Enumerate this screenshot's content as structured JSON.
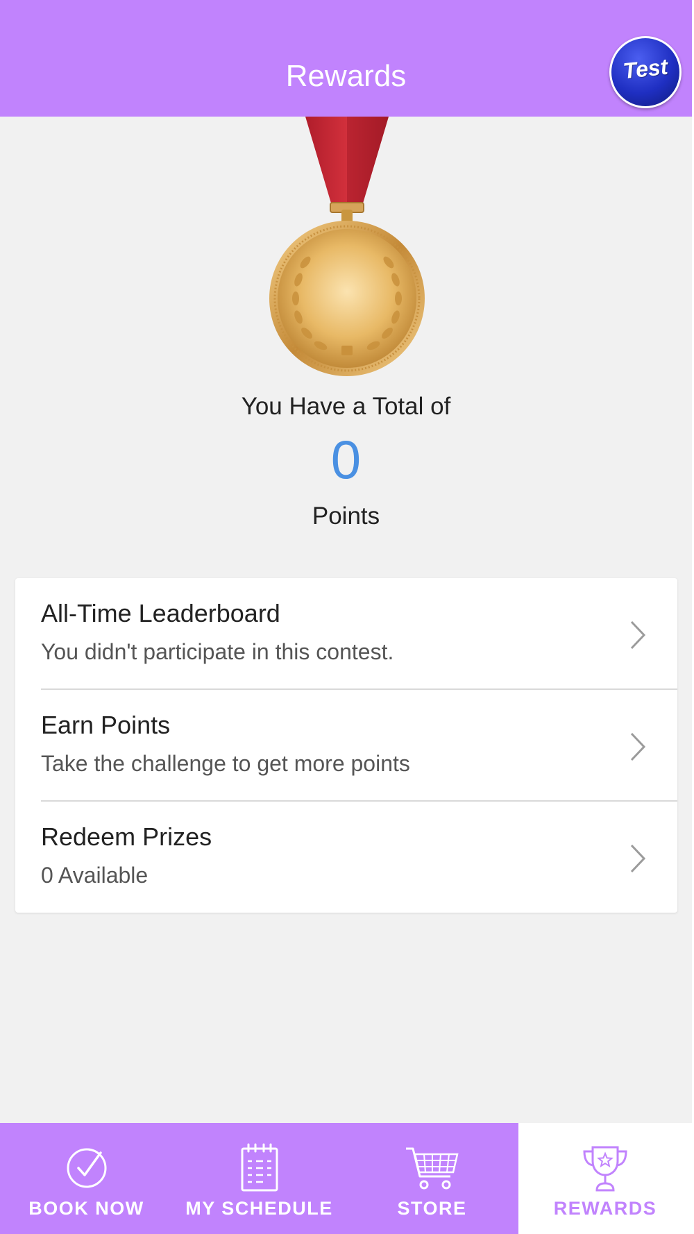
{
  "header": {
    "title": "Rewards",
    "avatar_text": "Test"
  },
  "summary": {
    "total_label": "You Have a Total of",
    "points_value": "0",
    "points_label": "Points"
  },
  "menu": {
    "items": [
      {
        "title": "All-Time Leaderboard",
        "subtitle": "You didn't participate in this contest."
      },
      {
        "title": "Earn Points",
        "subtitle": "Take the challenge to get more points"
      },
      {
        "title": "Redeem Prizes",
        "subtitle": "0 Available"
      }
    ]
  },
  "tabbar": {
    "tabs": [
      {
        "label": "BOOK NOW",
        "icon": "check-circle-icon",
        "active": false
      },
      {
        "label": "MY SCHEDULE",
        "icon": "calendar-icon",
        "active": false
      },
      {
        "label": "STORE",
        "icon": "cart-icon",
        "active": false
      },
      {
        "label": "REWARDS",
        "icon": "trophy-icon",
        "active": true
      }
    ]
  },
  "colors": {
    "brand_purple": "#c183fd",
    "points_blue": "#4a90e2",
    "ribbon_red": "#c0222f",
    "medal_gold": "#e2b35a"
  }
}
